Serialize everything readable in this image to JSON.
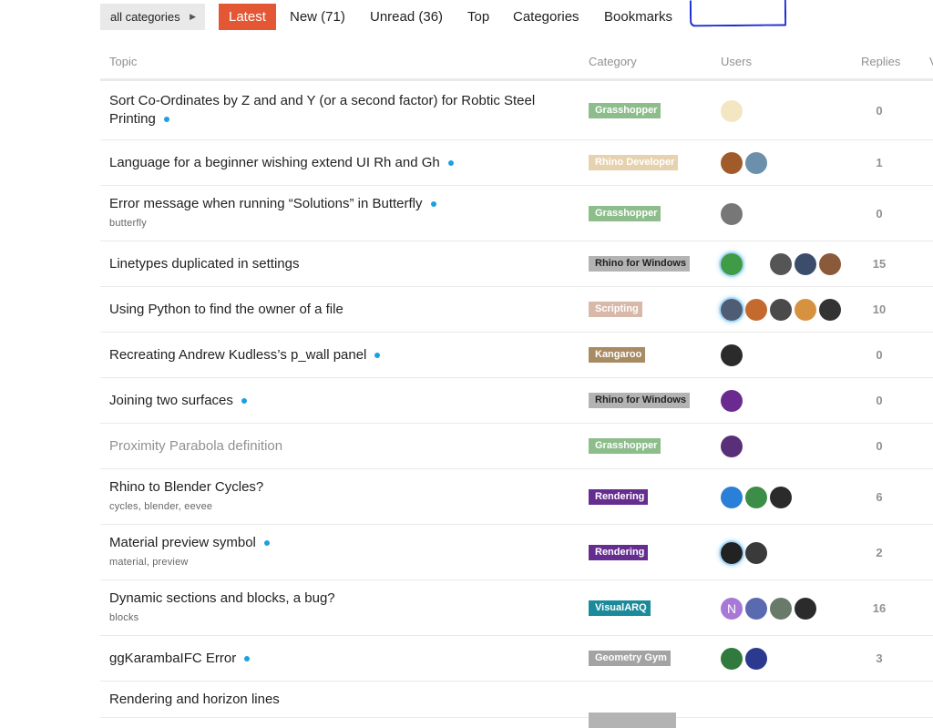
{
  "nav": {
    "dropdown_label": "all categories",
    "tabs": [
      "Latest",
      "New (71)",
      "Unread (36)",
      "Top",
      "Categories",
      "Bookmarks"
    ]
  },
  "columns": {
    "topic": "Topic",
    "category": "Category",
    "users": "Users",
    "replies": "Replies",
    "views_partial": "V"
  },
  "colors": {
    "accent": "#e45735",
    "unread_dot": "#1ba1e2"
  },
  "topics": [
    {
      "title": "Sort Co-Ordinates by Z and and Y (or a second factor) for Robtic Steel Printing",
      "unread": true,
      "tags": "",
      "category": "Grasshopper",
      "category_color": "#8cbd8b",
      "replies": "0",
      "avatars": [
        {
          "icon": "robot-avatar",
          "color": "#f3e6c2"
        }
      ]
    },
    {
      "title": "Language for a beginner wishing extend UI Rh and Gh",
      "unread": true,
      "tags": "",
      "category": "Rhino Developer",
      "category_color": "#e6d2ae",
      "replies": "1",
      "avatars": [
        {
          "icon": "pixel-face-avatar",
          "color": "#a15b2a"
        },
        {
          "icon": "landscape-avatar",
          "color": "#6c8fab"
        }
      ]
    },
    {
      "title": "Error message when running “Solutions” in Butterfly",
      "unread": true,
      "tags": "butterfly",
      "category": "Grasshopper",
      "category_color": "#8cbd8b",
      "replies": "0",
      "avatars": [
        {
          "icon": "person-avatar",
          "color": "#777777"
        }
      ]
    },
    {
      "title": "Linetypes duplicated in settings",
      "unread": false,
      "tags": "",
      "category": "Rhino for Windows",
      "category_color": "#b3b3b3",
      "dark_text": true,
      "replies": "15",
      "avatars": [
        {
          "icon": "pixel-avatar",
          "color": "#3f9b45",
          "glow": true
        },
        {
          "icon": "figure-avatar",
          "color": "#ffffff"
        },
        {
          "icon": "photo-avatar",
          "color": "#555555"
        },
        {
          "icon": "photo-avatar",
          "color": "#3b4d6b"
        },
        {
          "icon": "photo-avatar",
          "color": "#8a5a3a"
        }
      ]
    },
    {
      "title": "Using Python to find the owner of a file",
      "unread": false,
      "tags": "",
      "category": "Scripting",
      "category_color": "#d8b8a9",
      "replies": "10",
      "avatars": [
        {
          "icon": "portrait-avatar",
          "color": "#4e5d73",
          "glow": true
        },
        {
          "icon": "horn-avatar",
          "color": "#c46a2e"
        },
        {
          "icon": "photo-avatar",
          "color": "#4a4a4a"
        },
        {
          "icon": "cookie-avatar",
          "color": "#d6923f"
        },
        {
          "icon": "cartoon-avatar",
          "color": "#333333"
        }
      ]
    },
    {
      "title": "Recreating Andrew Kudless’s p_wall panel",
      "unread": true,
      "tags": "",
      "category": "Kangaroo",
      "category_color": "#a88b63",
      "replies": "0",
      "avatars": [
        {
          "icon": "person-avatar",
          "color": "#2b2b2b"
        }
      ]
    },
    {
      "title": "Joining two surfaces",
      "unread": true,
      "tags": "",
      "category": "Rhino for Windows",
      "category_color": "#b3b3b3",
      "dark_text": true,
      "replies": "0",
      "avatars": [
        {
          "icon": "pixel-avatar",
          "color": "#6a2a8f"
        }
      ]
    },
    {
      "title": "Proximity Parabola definition",
      "unread": false,
      "visited": true,
      "tags": "",
      "category": "Grasshopper",
      "category_color": "#8cbd8b",
      "replies": "0",
      "avatars": [
        {
          "icon": "pixel-avatar",
          "color": "#5a2f7a"
        }
      ]
    },
    {
      "title": "Rhino to Blender Cycles?",
      "unread": false,
      "tags": "cycles, blender, eevee",
      "category": "Rendering",
      "category_color": "#652d90",
      "replies": "6",
      "avatars": [
        {
          "icon": "blue-avatar",
          "color": "#2a7fd6"
        },
        {
          "icon": "pixel-avatar",
          "color": "#3c8d47"
        },
        {
          "icon": "person-avatar",
          "color": "#2b2b2b"
        }
      ]
    },
    {
      "title": "Material preview symbol",
      "unread": true,
      "tags": "material, preview",
      "category": "Rendering",
      "category_color": "#652d90",
      "replies": "2",
      "avatars": [
        {
          "icon": "portrait-avatar",
          "color": "#222222",
          "glow": true
        },
        {
          "icon": "person-avatar",
          "color": "#3a3a3a"
        }
      ]
    },
    {
      "title": "Dynamic sections and blocks, a bug?",
      "unread": false,
      "tags": "blocks",
      "category": "VisualARQ",
      "category_color": "#1b8a9a",
      "replies": "16",
      "avatars": [
        {
          "icon": "letter-avatar",
          "color": "#a878d6",
          "letter": "N"
        },
        {
          "icon": "pixel-avatar",
          "color": "#5a6ab0"
        },
        {
          "icon": "photo-avatar",
          "color": "#6a7a6a"
        },
        {
          "icon": "person-avatar",
          "color": "#2b2b2b"
        }
      ]
    },
    {
      "title": "ggKarambaIFC Error",
      "unread": true,
      "tags": "",
      "category": "Geometry Gym",
      "category_color": "#a3a3a3",
      "replies": "3",
      "avatars": [
        {
          "icon": "pixel-avatar",
          "color": "#2f7a3c"
        },
        {
          "icon": "pixel-avatar",
          "color": "#2b3a8f"
        }
      ]
    },
    {
      "title": "Rendering and horizon lines",
      "unread": false,
      "tags": "",
      "category": "",
      "category_color": "#b3b3b3",
      "replies": "",
      "avatars": []
    }
  ]
}
